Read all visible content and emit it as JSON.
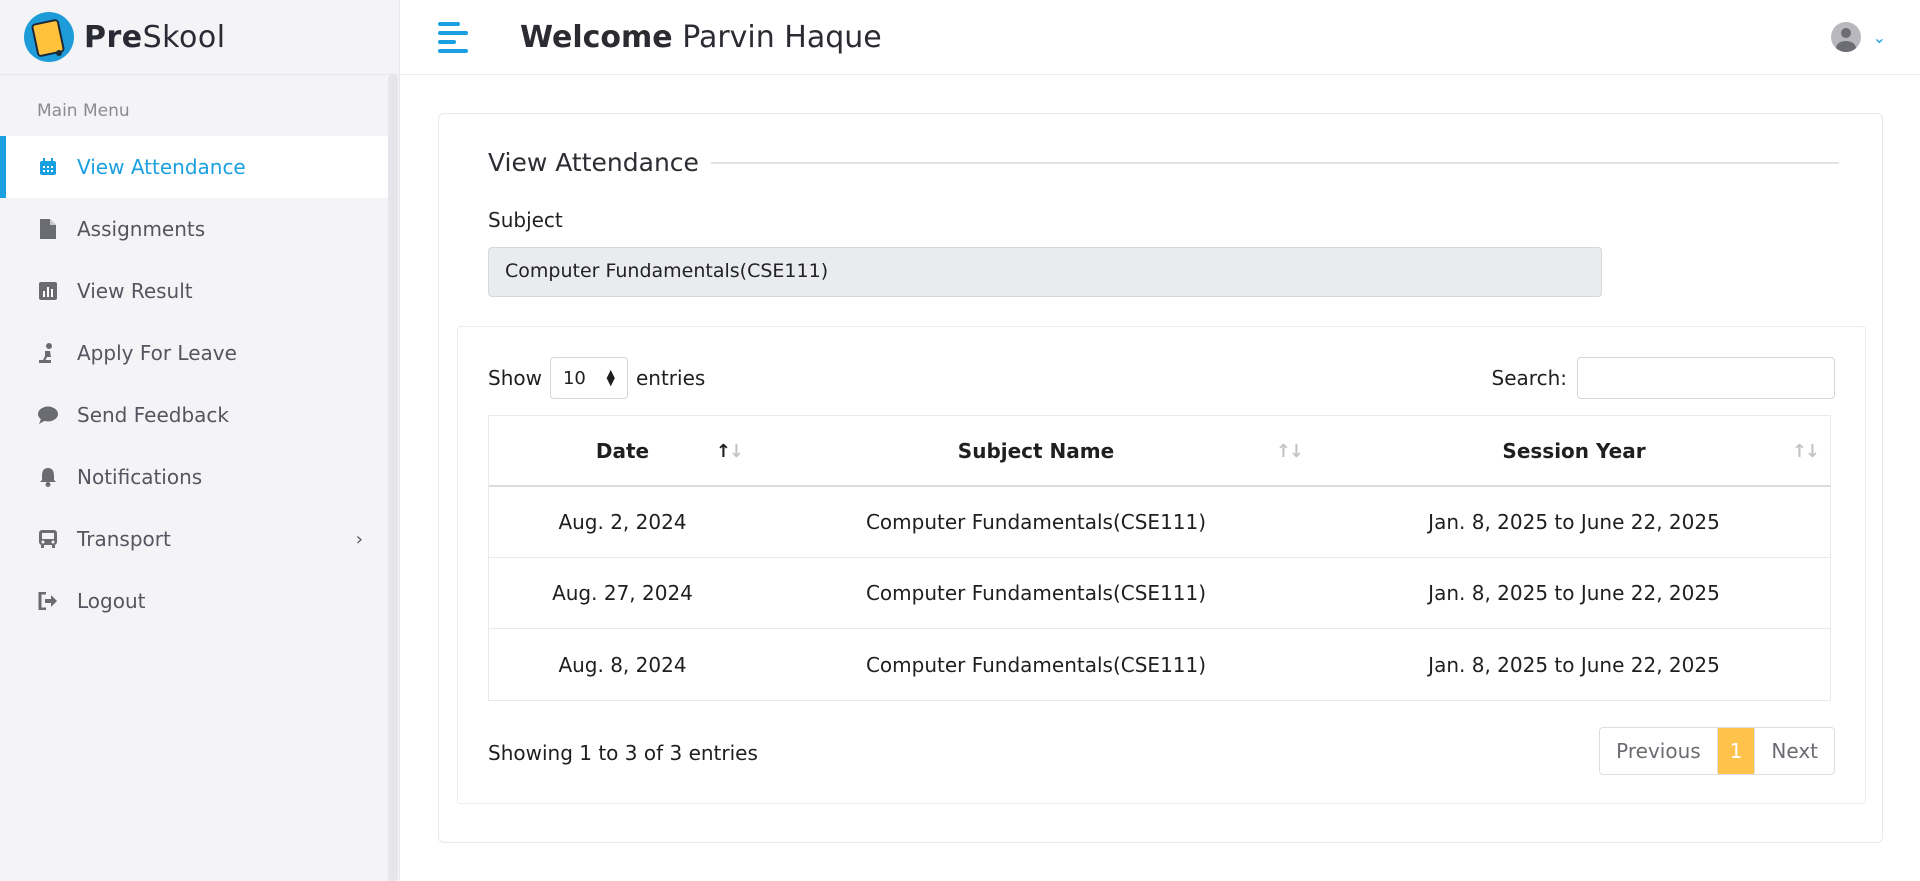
{
  "brand": {
    "name_bold": "Pre",
    "name_rest": "Skool"
  },
  "header": {
    "welcome_bold": "Welcome",
    "user_name": "Parvin Haque"
  },
  "sidebar": {
    "section_title": "Main Menu",
    "items": [
      {
        "label": "View Attendance",
        "icon": "calendar-icon",
        "active": true
      },
      {
        "label": "Assignments",
        "icon": "file-icon"
      },
      {
        "label": "View Result",
        "icon": "chart-icon"
      },
      {
        "label": "Apply For Leave",
        "icon": "person-icon"
      },
      {
        "label": "Send Feedback",
        "icon": "chat-icon"
      },
      {
        "label": "Notifications",
        "icon": "bell-icon"
      },
      {
        "label": "Transport",
        "icon": "bus-icon",
        "has_submenu": true
      },
      {
        "label": "Logout",
        "icon": "logout-icon"
      }
    ]
  },
  "card": {
    "title": "View Attendance",
    "subject_label": "Subject",
    "subject_value": "Computer Fundamentals(CSE111)"
  },
  "table_controls": {
    "show_label": "Show",
    "entries_value": "10",
    "entries_label": "entries",
    "search_label": "Search:"
  },
  "table": {
    "columns": [
      "Date",
      "Subject Name",
      "Session Year"
    ],
    "rows": [
      [
        "Aug. 2, 2024",
        "Computer Fundamentals(CSE111)",
        "Jan. 8, 2025 to June 22, 2025"
      ],
      [
        "Aug. 27, 2024",
        "Computer Fundamentals(CSE111)",
        "Jan. 8, 2025 to June 22, 2025"
      ],
      [
        "Aug. 8, 2024",
        "Computer Fundamentals(CSE111)",
        "Jan. 8, 2025 to June 22, 2025"
      ]
    ]
  },
  "pagination": {
    "info": "Showing 1 to 3 of 3 entries",
    "previous": "Previous",
    "current": "1",
    "next": "Next"
  },
  "colors": {
    "accent": "#1aa0e0",
    "page_active": "#ffc24b"
  }
}
